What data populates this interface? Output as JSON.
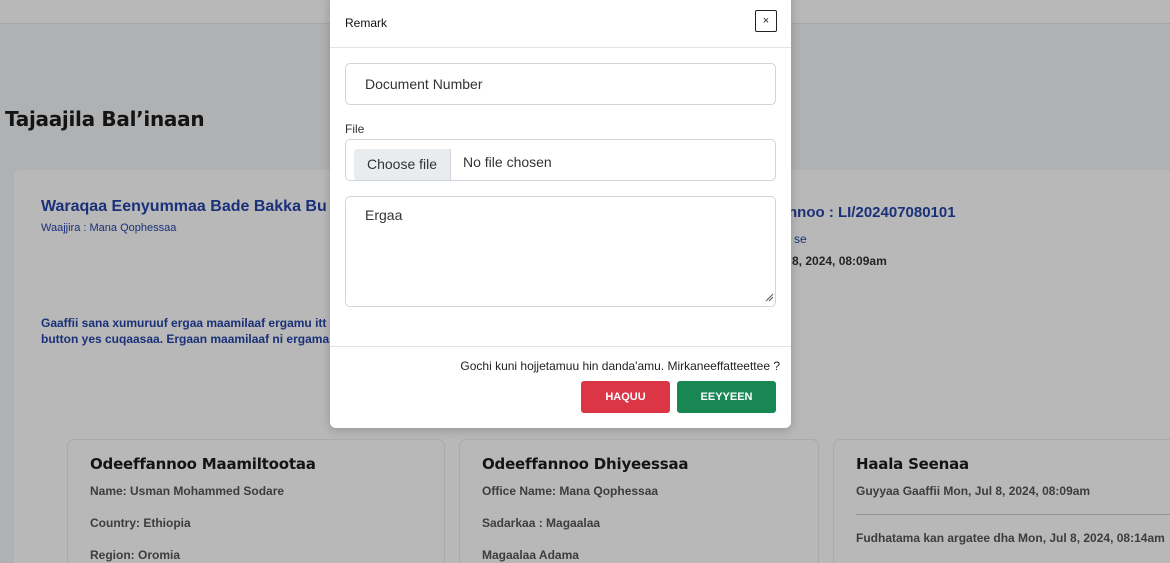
{
  "page": {
    "title": "Tajaajila Bal’inaan",
    "request_title": "Waraqaa Eenyummaa Bade Bakka Bu",
    "request_org": "Waajjira : Mana Qophessaa",
    "description_line1": "Gaaffii sana xumuruuf ergaa maamilaaf ergamu itt",
    "description_line2": "button yes cuqaasaa. Ergaan maamilaaf ni ergama",
    "lakk_number": "nnoo : LI/202407080101",
    "lakk_type": "se",
    "lakk_date": "8, 2024, 08:09am"
  },
  "cards": {
    "customer": {
      "title": "Odeeffannoo Maamiltootaa",
      "name": "Name: Usman Mohammed Sodare",
      "country": "Country: Ethiopia",
      "region": "Region: Oromia"
    },
    "provider": {
      "title": "Odeeffannoo Dhiyeessaa",
      "office": "Office Name: Mana Qophessaa",
      "sector": "Sadarkaa : Magaalaa",
      "city": "Magaalaa Adama"
    },
    "status": {
      "title": "Haala Seenaa",
      "submitted": "Guyyaa Gaaffii Mon, Jul 8, 2024, 08:09am",
      "accepted": "Fudhatama kan argatee dha Mon, Jul 8, 2024, 08:14am"
    }
  },
  "modal": {
    "title": "Remark",
    "close_label": "×",
    "document_number_placeholder": "Document Number",
    "file_label": "File",
    "choose_file_label": "Choose file",
    "file_status": "No file chosen",
    "message_placeholder": "Ergaa",
    "confirm_text": "Gochi kuni hojjetamuu hin danda'amu. Mirkaneeffatteettee ?",
    "no_label": "HAQUU",
    "yes_label": "EEYYEEN"
  }
}
